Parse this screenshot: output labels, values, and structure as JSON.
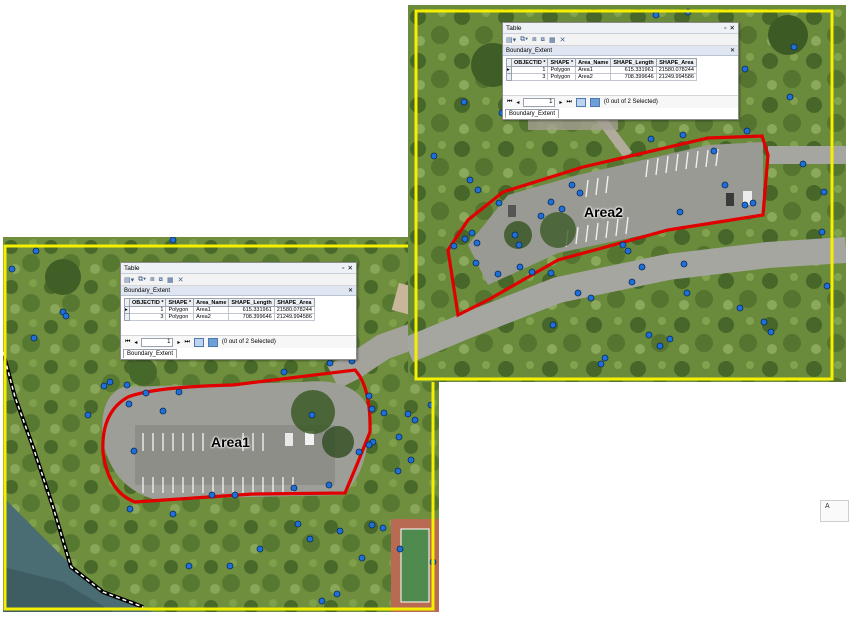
{
  "panels": [
    {
      "area_label": "Area1",
      "table": {
        "window_title": "Table",
        "layer": "Boundary_Extent",
        "columns": [
          "OBJECTID *",
          "SHAPE *",
          "Area_Name",
          "SHAPE_Length",
          "SHAPE_Area"
        ],
        "rows": [
          [
            "1",
            "Polygon",
            "Area1",
            "615.331961",
            "21580.078244"
          ],
          [
            "3",
            "Polygon",
            "Area2",
            "708.399646",
            "21249.994586"
          ]
        ],
        "record_position": "1",
        "selection_status": "(0 out of 2 Selected)",
        "tab_label": "Boundary_Extent"
      }
    },
    {
      "area_label": "Area2",
      "table": {
        "window_title": "Table",
        "layer": "Boundary_Extent",
        "columns": [
          "OBJECTID *",
          "SHAPE *",
          "Area_Name",
          "SHAPE_Length",
          "SHAPE_Area"
        ],
        "rows": [
          [
            "1",
            "Polygon",
            "Area1",
            "615.331961",
            "21580.078244"
          ],
          [
            "3",
            "Polygon",
            "Area2",
            "708.399646",
            "21249.994586"
          ]
        ],
        "record_position": "1",
        "selection_status": "(0 out of 2 Selected)",
        "tab_label": "Boundary_Extent"
      }
    }
  ],
  "stub_label": "A",
  "colors": {
    "extent_frame": "#f5f000",
    "boundary": "#e00000",
    "points": "#1e6fd9",
    "grass": "#6f8f3e",
    "pavement": "#9a9a94"
  },
  "icons": [
    "close-icon",
    "restore-icon",
    "table-options-icon",
    "select-icon",
    "first-record-icon",
    "prev-record-icon",
    "next-record-icon",
    "last-record-icon",
    "show-all-icon",
    "show-selected-icon"
  ]
}
